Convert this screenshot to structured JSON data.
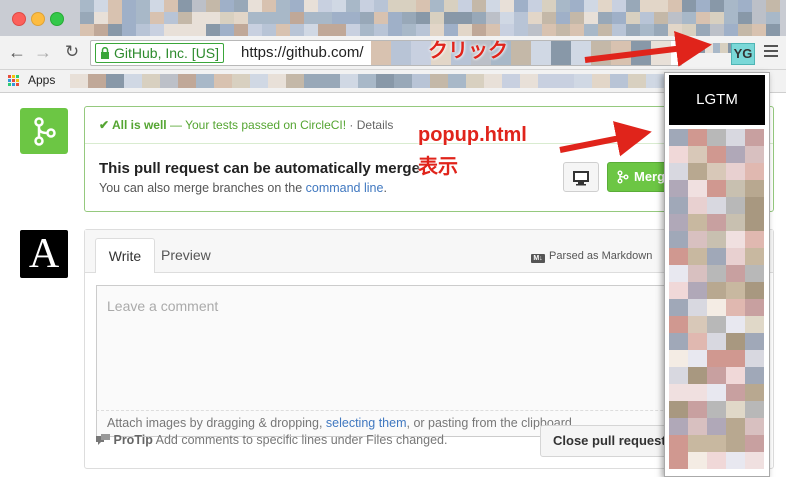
{
  "browser": {
    "address_bar": {
      "ev_badge": "GitHub, Inc. [US]",
      "url": "https://github.com/"
    },
    "extension_icon_text": "YG",
    "bookmarks": {
      "apps_label": "Apps"
    }
  },
  "pull_request": {
    "status": {
      "ok_label": "✔ All is well",
      "message": "— Your tests passed on CircleCI!",
      "details_link": "· Details"
    },
    "merge": {
      "title": "This pull request can be automatically merge",
      "subtitle_prefix": "You can also merge branches on the ",
      "subtitle_link": "command line",
      "subtitle_suffix": ".",
      "merge_button_label": "Merg"
    },
    "comment": {
      "tabs": [
        "Write",
        "Preview"
      ],
      "markdown_note": "Parsed as Markdown",
      "placeholder": "Leave a comment",
      "attach_prefix": "Attach images by dragging & dropping, ",
      "attach_link": "selecting them",
      "attach_suffix": ", or pasting from the clipboard.",
      "protip_label": "ProTip",
      "protip_text": " Add comments to specific lines under Files changed.",
      "close_button_label": "Close pull request"
    },
    "avatar_letter": "A"
  },
  "popup": {
    "lgtm_button_label": "LGTM"
  },
  "annotations": {
    "click_label": "クリック",
    "popup_label": "popup.html",
    "show_label": "表示"
  },
  "colors": {
    "annotation_red": "#e0241b",
    "github_green": "#6cc644",
    "link_blue": "#4078c0"
  }
}
